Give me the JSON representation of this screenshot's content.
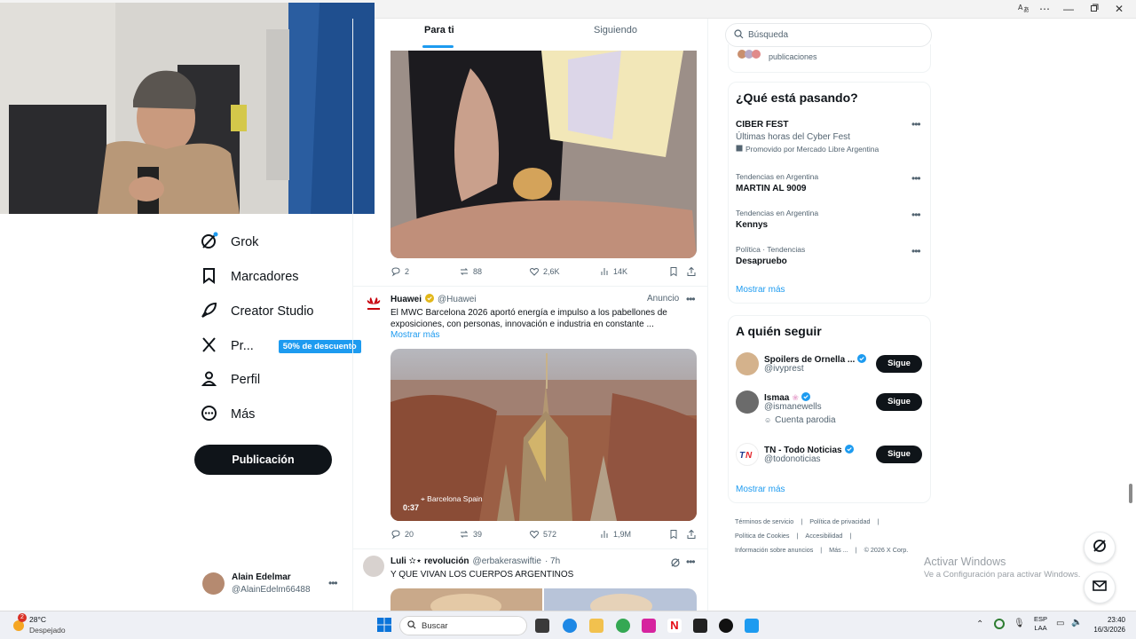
{
  "window": {
    "controls": [
      "translate-icon",
      "more-icon",
      "minimize-icon",
      "restore-icon",
      "close-icon"
    ]
  },
  "feed_tabs": {
    "for_you": "Para ti",
    "following": "Siguiendo"
  },
  "left_nav": {
    "items": [
      {
        "label": "Grok",
        "icon": "grok-icon"
      },
      {
        "label": "Marcadores",
        "icon": "bookmark-icon"
      },
      {
        "label": "Creator Studio",
        "icon": "rocket-icon"
      },
      {
        "label": "Pr...",
        "icon": "x-logo-icon",
        "badge": "50% de descuento"
      },
      {
        "label": "Perfil",
        "icon": "person-icon"
      },
      {
        "label": "Más",
        "icon": "more-circle-icon"
      }
    ],
    "post_button": "Publicación",
    "profile": {
      "name": "Alain Edelmar",
      "handle": "@AlainEdelm66488"
    }
  },
  "tweet1": {
    "replies": "2",
    "reposts": "88",
    "likes": "2,6K",
    "views": "14K"
  },
  "tweet2": {
    "name": "Huawei",
    "handle": "@Huawei",
    "ad": "Anuncio",
    "text": "El MWC Barcelona 2026 aportó energía e impulso a los pabellones de exposiciones, con personas, innovación e industria en constante ...",
    "show_more": "Mostrar más",
    "video_location": "Barcelona Spain",
    "video_time": "0:37",
    "replies": "20",
    "reposts": "39",
    "likes": "572",
    "views": "1,9M"
  },
  "tweet3": {
    "name": "Luli ✫⋆ revolución",
    "handle": "@erbakeraswiftie",
    "time": "· 7h",
    "text": "Y QUE VIVAN LOS CUERPOS ARGENTINOS"
  },
  "search": {
    "placeholder": "Búsqueda"
  },
  "top_card": {
    "text": "publicaciones"
  },
  "trends": {
    "title": "¿Qué está pasando?",
    "items": [
      {
        "meta": "",
        "title": "CIBER FEST",
        "subtitle": "Últimas horas del Cyber Fest",
        "promo": "Promovido por Mercado Libre Argentina"
      },
      {
        "meta": "Tendencias en Argentina",
        "title": "MARTIN AL 9009"
      },
      {
        "meta": "Tendencias en Argentina",
        "title": "Kennys"
      },
      {
        "meta": "Política · Tendencias",
        "title": "Desapruebo"
      }
    ],
    "show_more": "Mostrar más"
  },
  "who_to_follow": {
    "title": "A quién seguir",
    "users": [
      {
        "name": "Spoilers de Ornella ...",
        "handle": "@ivyprest",
        "extra": "",
        "button": "Sigue"
      },
      {
        "name": "Ismaa",
        "handle": "@ismanewells",
        "extra": "Cuenta parodia",
        "button": "Sigue"
      },
      {
        "name": "TN - Todo Noticias",
        "handle": "@todonoticias",
        "extra": "",
        "button": "Sigue"
      }
    ],
    "show_more": "Mostrar más"
  },
  "footer": {
    "row1": [
      "Términos de servicio",
      "|",
      "Política de privacidad",
      "|"
    ],
    "row2": [
      "Política de Cookies",
      "|",
      "Accesibilidad",
      "|"
    ],
    "row3": [
      "Información sobre anuncios",
      "|",
      "Más ...",
      "|",
      "© 2026 X Corp."
    ]
  },
  "watermark": {
    "title": "Activar Windows",
    "subtitle": "Ve a Configuración para activar Windows."
  },
  "taskbar": {
    "weather_temp": "28°C",
    "weather_text": "Despejado",
    "weather_badge": "2",
    "search": "Buscar",
    "lang1": "ESP",
    "lang2": "LAA",
    "time": "23:40",
    "date": "16/3/2026"
  },
  "colors": {
    "accent": "#1d9bf0",
    "text": "#0f1419",
    "muted": "#536471"
  }
}
